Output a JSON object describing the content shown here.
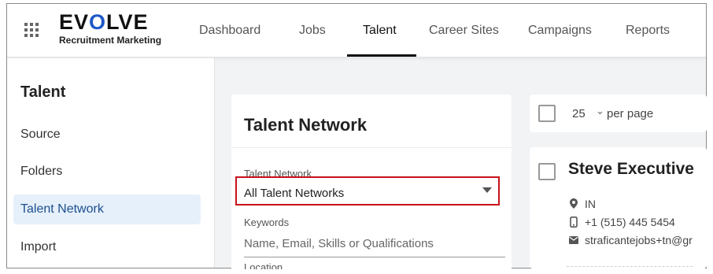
{
  "logo": {
    "main_prefix": "EV",
    "main_o": "O",
    "main_suffix": "LVE",
    "subtitle": "Recruitment Marketing"
  },
  "nav": {
    "tabs": [
      {
        "label": "Dashboard"
      },
      {
        "label": "Jobs"
      },
      {
        "label": "Talent",
        "active": true
      },
      {
        "label": "Career Sites"
      },
      {
        "label": "Campaigns"
      },
      {
        "label": "Reports"
      }
    ]
  },
  "sidebar": {
    "title": "Talent",
    "items": [
      {
        "label": "Source"
      },
      {
        "label": "Folders"
      },
      {
        "label": "Talent Network",
        "active": true
      },
      {
        "label": "Import"
      }
    ]
  },
  "filter": {
    "title": "Talent Network",
    "network_label": "Talent Network",
    "network_value": "All Talent Networks",
    "keywords_label": "Keywords",
    "keywords_placeholder": "Name, Email, Skills or Qualifications",
    "location_label": "Location"
  },
  "pager": {
    "per_page_value": "25",
    "chevron": "⌄",
    "per_page_label": "per page"
  },
  "person": {
    "name": "Steve Executive",
    "location": "IN",
    "phone": "+1 (515) 445 5454",
    "email": "straficantejobs+tn@gr"
  },
  "icons": {
    "location": "map-pin-icon",
    "phone": "mobile-phone-icon",
    "email": "envelope-icon"
  },
  "colors": {
    "accent_blue": "#1e57c8",
    "active_bg": "#e6f0fb",
    "highlight_red": "#c8101a"
  }
}
